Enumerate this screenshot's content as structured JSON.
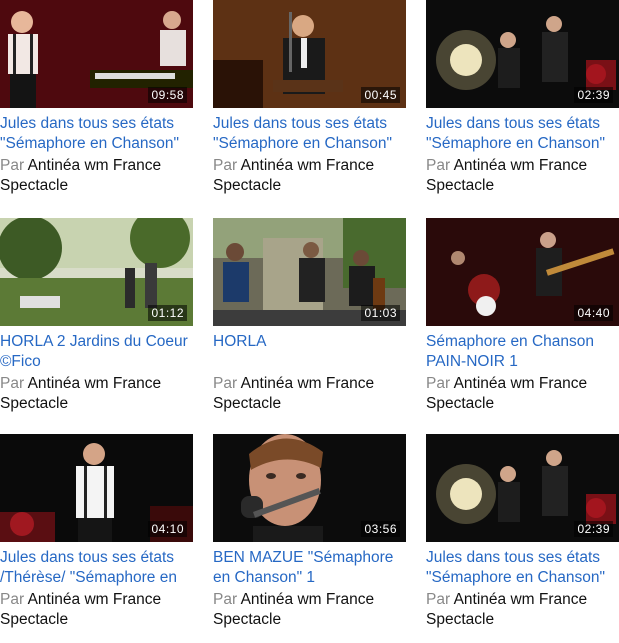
{
  "videos": [
    {
      "title": "Jules dans tous ses états \"Sémaphore en Chanson\"",
      "duration": "09:58",
      "by": "Par",
      "owner": "Antinéa wm France",
      "owner2": "Spectacle"
    },
    {
      "title": "Jules dans tous ses états \"Sémaphore en Chanson\"",
      "duration": "00:45",
      "by": "Par",
      "owner": "Antinéa wm France",
      "owner2": "Spectacle"
    },
    {
      "title": "Jules dans tous ses états \"Sémaphore en Chanson\"",
      "duration": "02:39",
      "by": "Par",
      "owner": "Antinéa wm France",
      "owner2": "Spectacle"
    },
    {
      "title": "HORLA 2 Jardins du Coeur ©Fico",
      "duration": "01:12",
      "by": "Par",
      "owner": "Antinéa wm France",
      "owner2": "Spectacle"
    },
    {
      "title": "HORLA",
      "duration": "01:03",
      "by": "Par",
      "owner": "Antinéa wm France",
      "owner2": "Spectacle"
    },
    {
      "title": "Sémaphore en Chanson PAIN-NOIR 1",
      "duration": "04:40",
      "by": "Par",
      "owner": "Antinéa wm France",
      "owner2": "Spectacle"
    },
    {
      "title": "Jules dans tous ses états /Thérèse/ \"Sémaphore en",
      "duration": "04:10",
      "by": "Par",
      "owner": "Antinéa wm France",
      "owner2": "Spectacle"
    },
    {
      "title": "BEN MAZUE \"Sémaphore en Chanson\" 1",
      "duration": "03:56",
      "by": "Par",
      "owner": "Antinéa wm France",
      "owner2": "Spectacle"
    },
    {
      "title": "Jules dans tous ses états \"Sémaphore en Chanson\"",
      "duration": "02:39",
      "by": "Par",
      "owner": "Antinéa wm France",
      "owner2": "Spectacle"
    }
  ],
  "colors": {
    "link": "#2668c4",
    "by": "#888888",
    "owner": "#111111"
  }
}
